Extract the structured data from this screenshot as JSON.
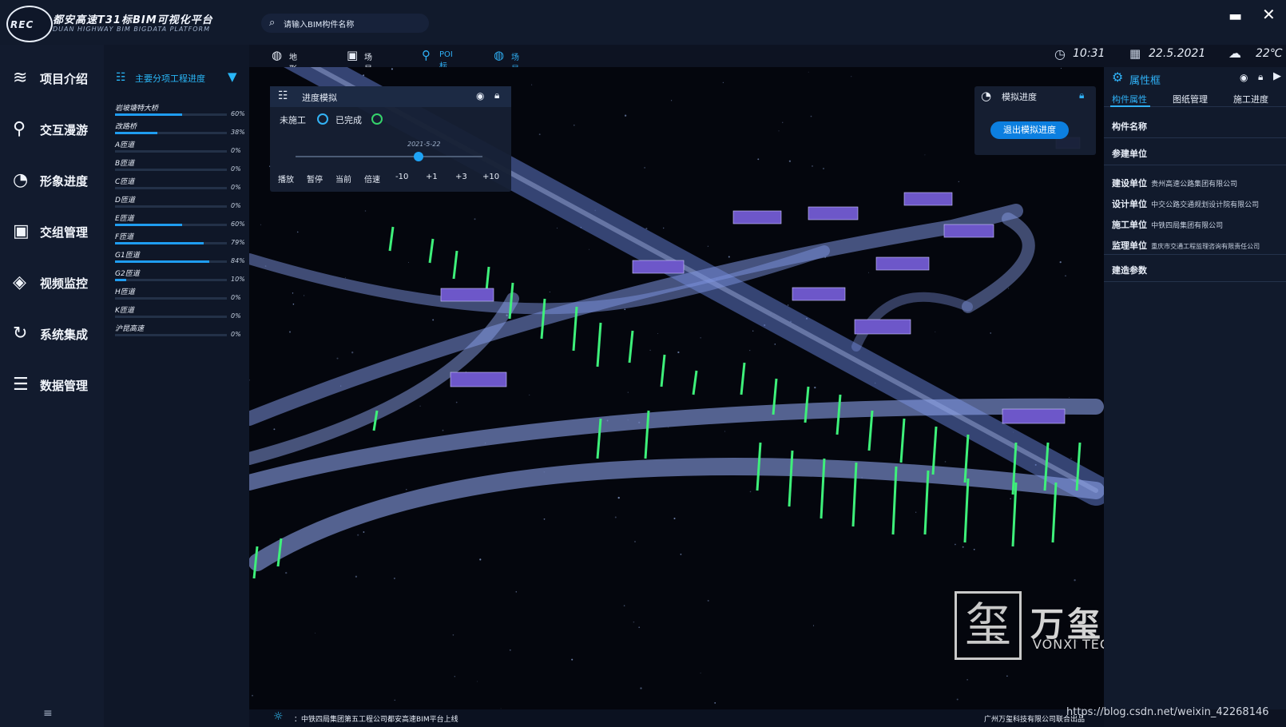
{
  "app": {
    "logo_text": "REC",
    "title": "都安高速T31标BIM可视化平台",
    "subtitle": "DUAN HIGHWAY BIM BIGDATA PLATFORM"
  },
  "search": {
    "placeholder": "请输入BIM构件名称"
  },
  "leftnav": {
    "items": [
      {
        "label": "项目介绍",
        "icon": "layers-icon"
      },
      {
        "label": "交互漫游",
        "icon": "location-pin-icon"
      },
      {
        "label": "形象进度",
        "icon": "pie-chart-icon"
      },
      {
        "label": "交组管理",
        "icon": "train-icon"
      },
      {
        "label": "视频监控",
        "icon": "camera-icon"
      },
      {
        "label": "系统集成",
        "icon": "integration-icon"
      },
      {
        "label": "数据管理",
        "icon": "database-icon"
      }
    ]
  },
  "progress": {
    "title": "主要分项工程进度",
    "items": [
      {
        "name": "岩坡塘特大桥",
        "value": 0.6,
        "pct": "60%"
      },
      {
        "name": "改路桥",
        "value": 0.38,
        "pct": "38%"
      },
      {
        "name": "A匝道",
        "value": 0,
        "pct": "0%"
      },
      {
        "name": "B匝道",
        "value": 0,
        "pct": "0%"
      },
      {
        "name": "C匝道",
        "value": 0,
        "pct": "0%"
      },
      {
        "name": "D匝道",
        "value": 0,
        "pct": "0%"
      },
      {
        "name": "E匝道",
        "value": 0.6,
        "pct": "60%"
      },
      {
        "name": "F匝道",
        "value": 0.79,
        "pct": "79%"
      },
      {
        "name": "G1匝道",
        "value": 0.84,
        "pct": "84%"
      },
      {
        "name": "G2匝道",
        "value": 0.1,
        "pct": "10%"
      },
      {
        "name": "H匝道",
        "value": 0,
        "pct": "0%"
      },
      {
        "name": "K匝道",
        "value": 0,
        "pct": "0%"
      },
      {
        "name": "沪昆高速",
        "value": 0,
        "pct": "0%"
      }
    ]
  },
  "toolbar": {
    "items": [
      {
        "label": "地形显示",
        "icon": "globe-icon",
        "color": "#e8eef8"
      },
      {
        "label": "场景漫游",
        "icon": "train-icon",
        "color": "#e8eef8"
      },
      {
        "label": "POI标识",
        "icon": "poi-pin-icon",
        "color": "#2fb0f5"
      },
      {
        "label": "场景音乐",
        "icon": "earth-music-icon",
        "color": "#2fb0f5"
      }
    ]
  },
  "status": {
    "time": "10:31",
    "date": "22.5.2021",
    "temperature": "22℃"
  },
  "simulation": {
    "title": "进度模拟",
    "legend_unbuilt": "未施工",
    "legend_done": "已完成",
    "date": "2021-5-22",
    "slider_position": 0.66,
    "buttons": [
      "播放",
      "暂停",
      "当前",
      "倍速",
      "-10",
      "+1",
      "+3",
      "+10"
    ]
  },
  "sim_progress": {
    "title": "模拟进度",
    "exit_button": "退出模拟进度"
  },
  "properties": {
    "title": "属性框",
    "tabs": [
      "构件属性",
      "图纸管理",
      "施工进度"
    ],
    "component_name_label": "构件名称",
    "participants_label": "参建单位",
    "units": [
      {
        "label": "建设单位",
        "value": "贵州高速公路集团有限公司"
      },
      {
        "label": "设计单位",
        "value": "中交公路交通规划设计院有限公司"
      },
      {
        "label": "施工单位",
        "value": "中铁四局集团有限公司"
      },
      {
        "label": "监理单位",
        "value": "重庆市交通工程监理咨询有限责任公司"
      }
    ],
    "params_label": "建造参数"
  },
  "footer": {
    "left": "：中铁四局集团第五工程公司都安高速BIM平台上线",
    "right": "广州万玺科技有限公司联合出品"
  },
  "watermark": {
    "mark": "玺",
    "cn": "万玺科技",
    "en": "VONXI TECHNOLOGY"
  },
  "credit": "https://blog.csdn.net/weixin_42268146",
  "colors": {
    "accent": "#2fb0f5",
    "bar": "#1f9df0",
    "pier": "#3ef07a",
    "road": "#7f96e0",
    "tag": "#6d57c9"
  }
}
